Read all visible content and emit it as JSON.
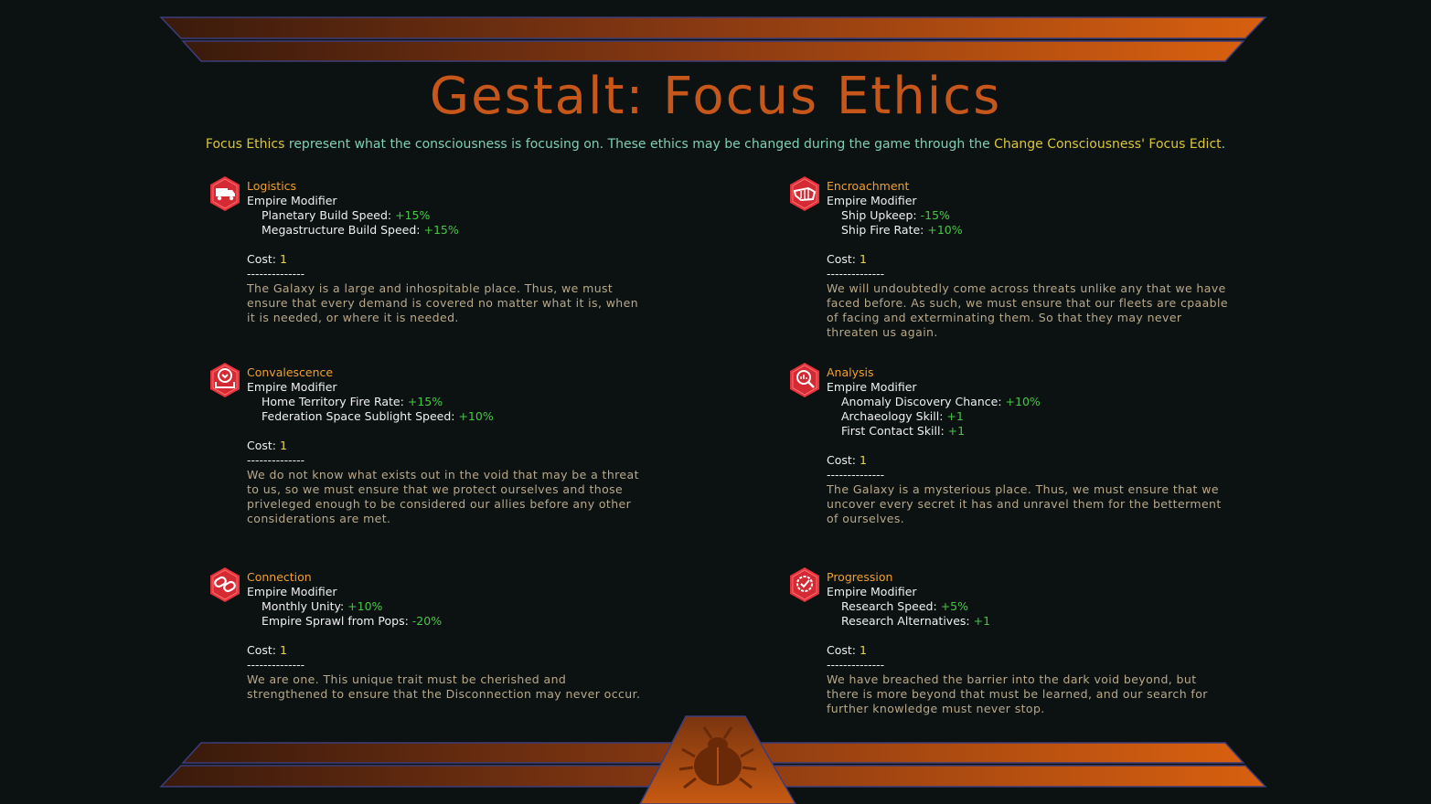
{
  "title": "Gestalt: Focus Ethics",
  "subtitle": {
    "part1": "Focus Ethics",
    "part2": " represent what the consciousness is focusing on. These ethics may be changed during the game through the ",
    "part3": "Change Consciousness' Focus Edict",
    "part4": "."
  },
  "colors": {
    "accent": "#c6561a",
    "name": "#f0a030",
    "positive": "#45c745",
    "cost": "#e8d84a",
    "desc": "#b9a88a",
    "icon": "#e8323c"
  },
  "items": [
    {
      "name": "Logistics",
      "icon": "truck-icon",
      "modifier_label": "Empire Modifier",
      "effects": [
        {
          "label": "Planetary Build Speed: ",
          "value": "+15%"
        },
        {
          "label": "Megastructure Build Speed: ",
          "value": "+15%"
        }
      ],
      "cost_label": "Cost: ",
      "cost": "1",
      "separator": "--------------",
      "description": "The Galaxy is a large and inhospitable place. Thus, we must ensure that every demand is covered no matter what it is, when it is needed, or where it is needed."
    },
    {
      "name": "Encroachment",
      "icon": "fist-icon",
      "modifier_label": "Empire Modifier",
      "effects": [
        {
          "label": "Ship Upkeep: ",
          "value": "-15%"
        },
        {
          "label": "Ship Fire Rate: ",
          "value": "+10%"
        }
      ],
      "cost_label": "Cost: ",
      "cost": "1",
      "separator": "--------------",
      "description": "We will undoubtedly come across threats unlike any that we have faced before. As such, we must ensure that our fleets are cpaable of facing and exterminating them. So that they may never threaten us again."
    },
    {
      "name": "Convalescence",
      "icon": "hand-heart-icon",
      "modifier_label": "Empire Modifier",
      "effects": [
        {
          "label": "Home Territory Fire Rate: ",
          "value": "+15%"
        },
        {
          "label": "Federation Space Sublight Speed: ",
          "value": "+10%"
        }
      ],
      "cost_label": "Cost: ",
      "cost": "1",
      "separator": "--------------",
      "description": "We do not know what exists out in the void that may be a threat to us, so we must ensure that we protect ourselves and those priveleged enough to be considered our allies before any other considerations are met."
    },
    {
      "name": "Analysis",
      "icon": "magnifier-chart-icon",
      "modifier_label": "Empire Modifier",
      "effects": [
        {
          "label": "Anomaly Discovery Chance: ",
          "value": "+10%"
        },
        {
          "label": "Archaeology Skill: ",
          "value": "+1"
        },
        {
          "label": "First Contact Skill: ",
          "value": "+1"
        }
      ],
      "cost_label": "Cost: ",
      "cost": "1",
      "separator": "--------------",
      "description": "The Galaxy is a mysterious place. Thus, we must ensure that we uncover every secret it has and unravel them for the betterment of ourselves."
    },
    {
      "name": "Connection",
      "icon": "chain-link-icon",
      "modifier_label": "Empire Modifier",
      "effects": [
        {
          "label": "Monthly Unity: ",
          "value": "+10%"
        },
        {
          "label": "Empire Sprawl from Pops: ",
          "value": "-20%"
        }
      ],
      "cost_label": "Cost: ",
      "cost": "1",
      "separator": "--------------",
      "description": "We are one. This unique trait must be cherished and strengthened to ensure that the Disconnection may never occur."
    },
    {
      "name": "Progression",
      "icon": "checkmark-gear-icon",
      "modifier_label": "Empire Modifier",
      "effects": [
        {
          "label": "Research Speed: ",
          "value": "+5%"
        },
        {
          "label": "Research Alternatives: ",
          "value": "+1"
        }
      ],
      "cost_label": "Cost: ",
      "cost": "1",
      "separator": "--------------",
      "description": "We have breached the barrier into the dark void beyond, but there is more beyond that must be learned, and our search for further knowledge must never stop."
    }
  ],
  "emblem": "beetle-emblem-icon"
}
